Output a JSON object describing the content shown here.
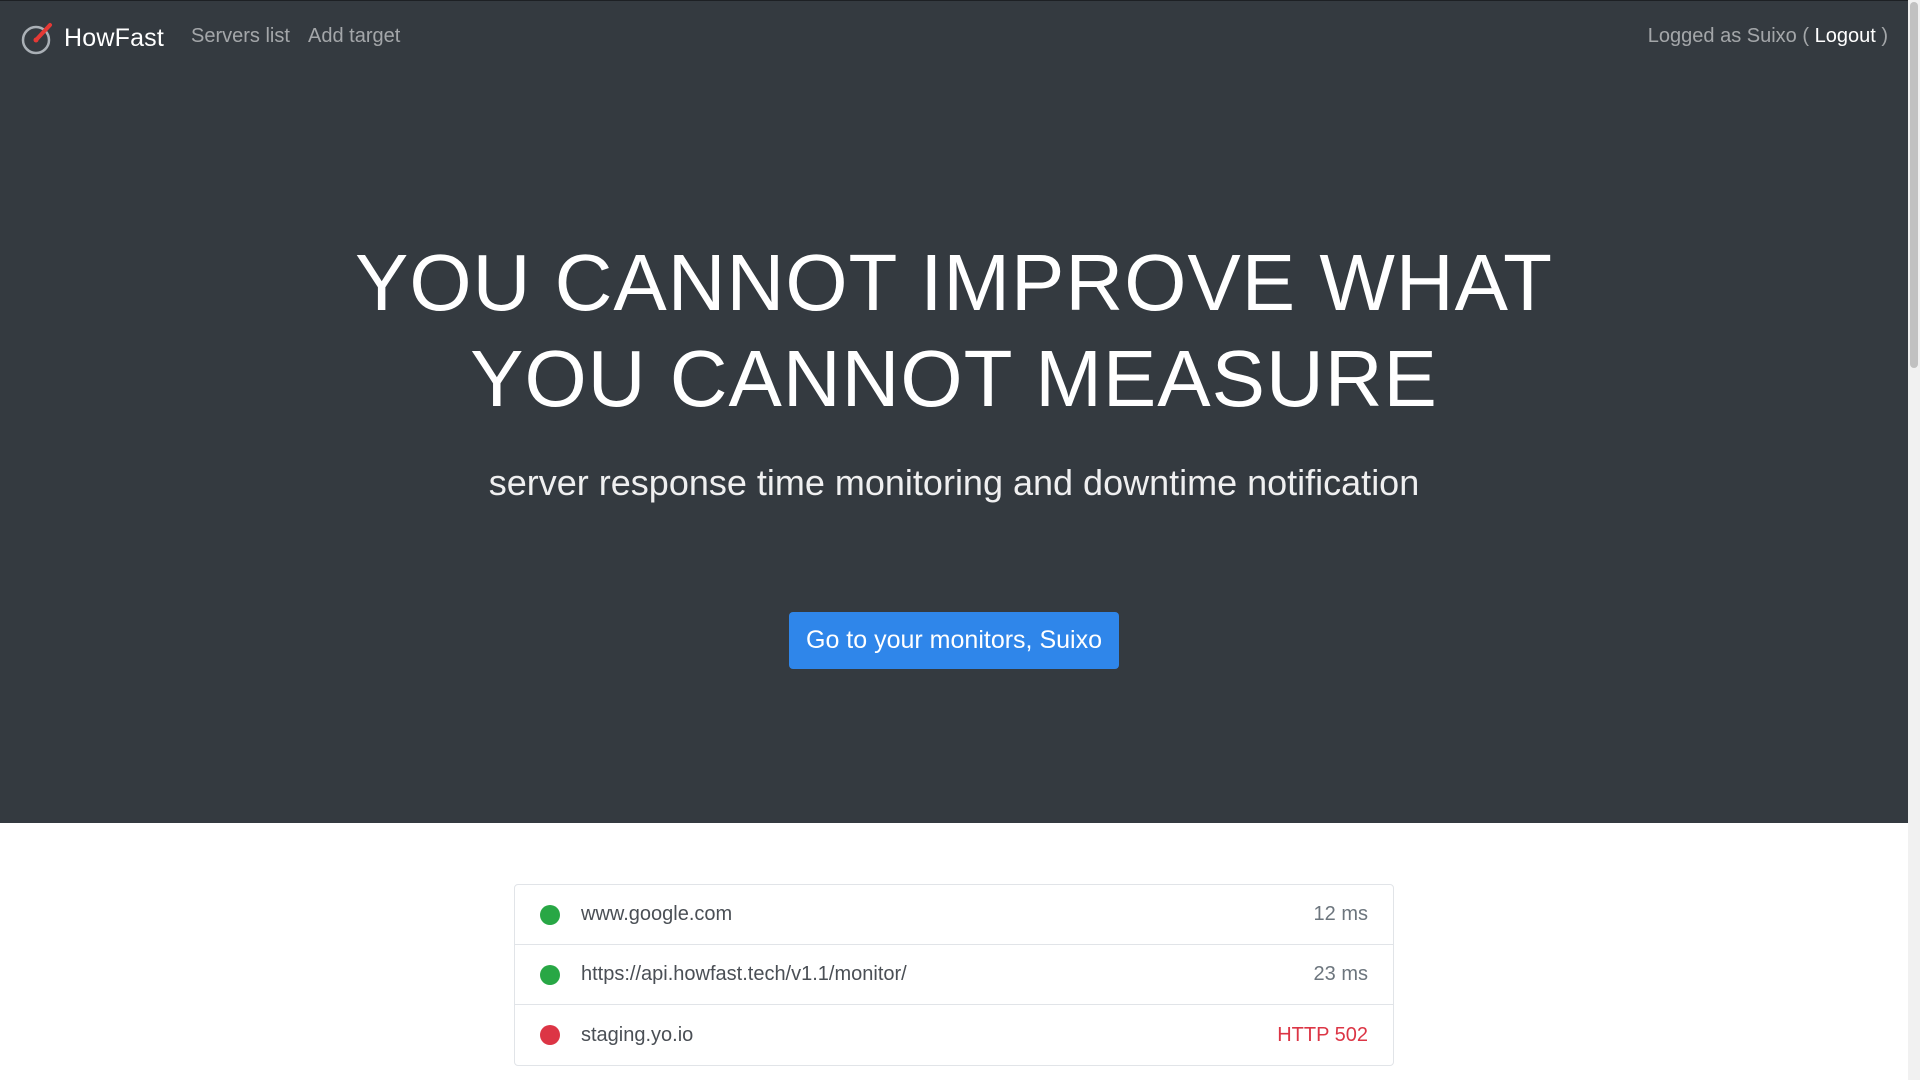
{
  "navbar": {
    "brand": "HowFast",
    "links": [
      "Servers list",
      "Add target"
    ],
    "login_prefix": "Logged as Suixo (",
    "logout": "Logout",
    "login_suffix": ")"
  },
  "hero": {
    "headline_line1": "YOU CANNOT IMPROVE WHAT",
    "headline_line2": "YOU CANNOT MEASURE",
    "subtitle": "server response time monitoring and downtime notification",
    "cta_label": "Go to your monitors, Suixo"
  },
  "monitors": [
    {
      "url": "www.google.com",
      "value": "12 ms",
      "status": "up",
      "status_color": "#28a745"
    },
    {
      "url": "https://api.howfast.tech/v1.1/monitor/",
      "value": "23 ms",
      "status": "up",
      "status_color": "#28a745"
    },
    {
      "url": "staging.yo.io",
      "value": "HTTP 502",
      "status": "down",
      "status_color": "#dc3545"
    }
  ],
  "colors": {
    "hero_bg": "#343a40",
    "primary": "#2f86ea",
    "success": "#28a745",
    "danger": "#dc3545"
  },
  "icons": {
    "logo": "stopwatch-icon"
  }
}
